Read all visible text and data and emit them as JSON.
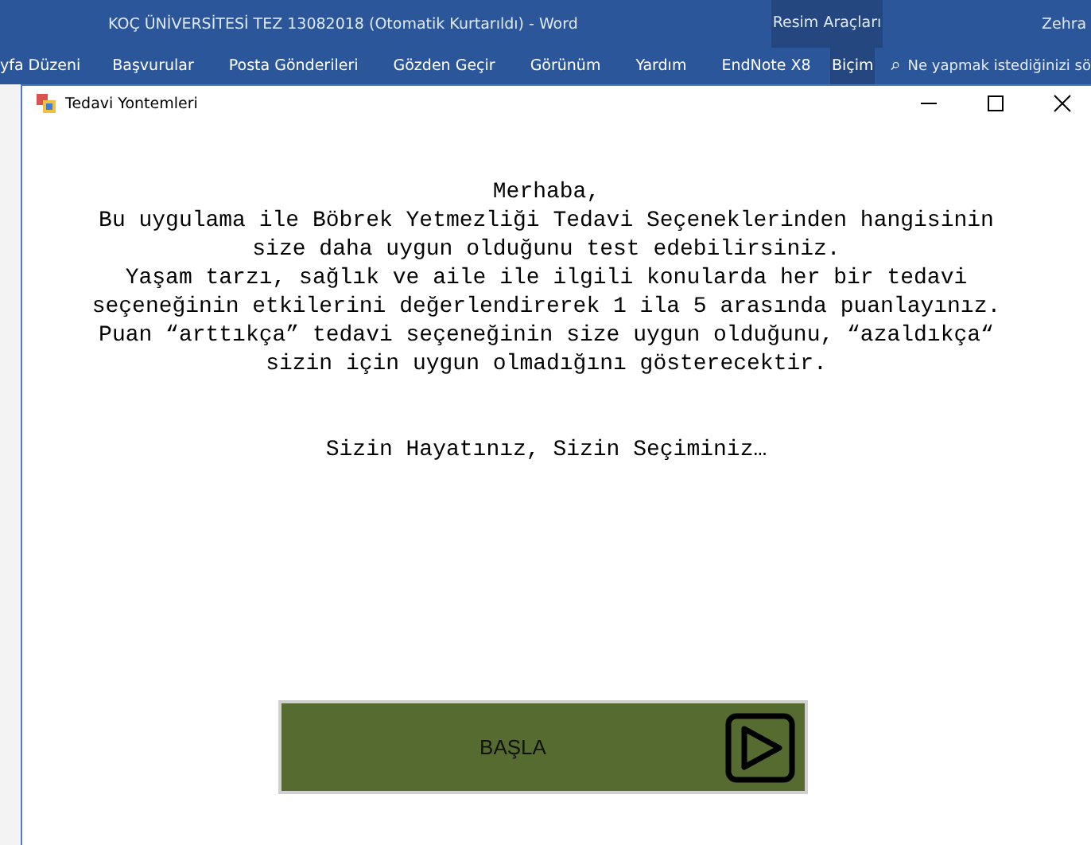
{
  "word": {
    "title": "KOÇ ÜNİVERSİTESİ TEZ 13082018 (Otomatik Kurtarıldı)  -  Word",
    "context_tab": "Resim Araçları",
    "user": "Zehra",
    "ribbon_tabs": [
      {
        "label": "yfa Düzeni",
        "selected": false
      },
      {
        "label": "Başvurular",
        "selected": false
      },
      {
        "label": "Posta Gönderileri",
        "selected": false
      },
      {
        "label": "Gözden Geçir",
        "selected": false
      },
      {
        "label": "Görünüm",
        "selected": false
      },
      {
        "label": "Yardım",
        "selected": false
      },
      {
        "label": "EndNote X8",
        "selected": false
      },
      {
        "label": "Biçim",
        "selected": false
      }
    ],
    "search": {
      "placeholder": "Ne yapmak istediğinizi sö"
    }
  },
  "dialog": {
    "title": "Tedavi Yontemleri",
    "message_lines": [
      "Merhaba,",
      "Bu uygulama ile Böbrek Yetmezliği Tedavi Seçeneklerinden hangisinin",
      "size daha uygun olduğunu test edebilirsiniz.",
      "Yaşam tarzı, sağlık ve aile ile ilgili konularda her bir tedavi",
      "seçeneğinin etkilerini değerlendirerek 1 ila 5 arasında puanlayınız.",
      "Puan “arttıkça” tedavi seçeneğinin size uygun olduğunu, “azaldıkça“",
      "sizin için uygun olmadığını gösterecektir."
    ],
    "slogan": "Sizin Hayatınız, Sizin Seçiminiz…",
    "start_button": "BAŞLA"
  }
}
